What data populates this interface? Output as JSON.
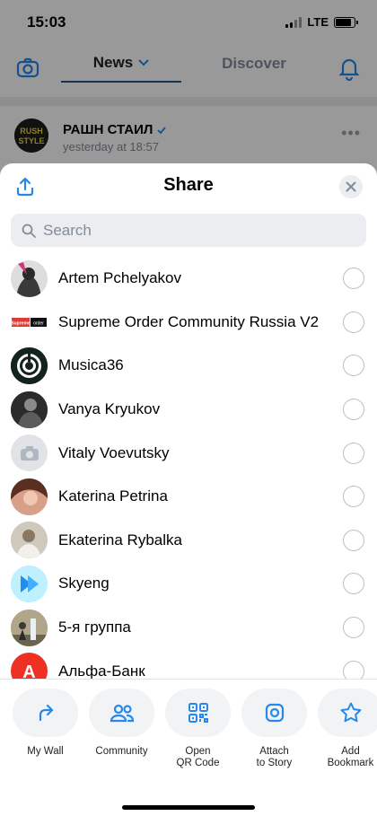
{
  "status_bar": {
    "time": "15:03",
    "network": "LTE",
    "battery_percent": 85
  },
  "app_header": {
    "tab_news": "News",
    "tab_discover": "Discover"
  },
  "post": {
    "author": "РАШН СТАИЛ",
    "time": "yesterday at 18:57"
  },
  "sheet": {
    "title": "Share",
    "search_placeholder": "Search",
    "contacts": [
      {
        "name": "Artem Pchelyakov",
        "selected": false
      },
      {
        "name": "Supreme Order Community Russia V2",
        "selected": false
      },
      {
        "name": "Musica36",
        "selected": false
      },
      {
        "name": "Vanya Kryukov",
        "selected": false
      },
      {
        "name": "Vitaly Voevutsky",
        "selected": false
      },
      {
        "name": "Katerina Petrina",
        "selected": false
      },
      {
        "name": "Ekaterina Rybalka",
        "selected": false
      },
      {
        "name": "Skyeng",
        "selected": false
      },
      {
        "name": "5-я группа",
        "selected": false
      },
      {
        "name": "Альфа-Банк",
        "selected": false
      }
    ],
    "actions": [
      {
        "label": "My Wall",
        "icon": "share-arrow-icon"
      },
      {
        "label": "Community",
        "icon": "users-icon"
      },
      {
        "label": "Open\nQR Code",
        "icon": "qr-code-icon"
      },
      {
        "label": "Attach\nto Story",
        "icon": "story-icon"
      },
      {
        "label": "Add\nBookmark",
        "icon": "star-icon"
      }
    ]
  },
  "colors": {
    "accent": "#2688eb",
    "radio_border": "#b8c1cc",
    "search_bg": "#ebedf0",
    "alfa_red": "#ef3124"
  }
}
